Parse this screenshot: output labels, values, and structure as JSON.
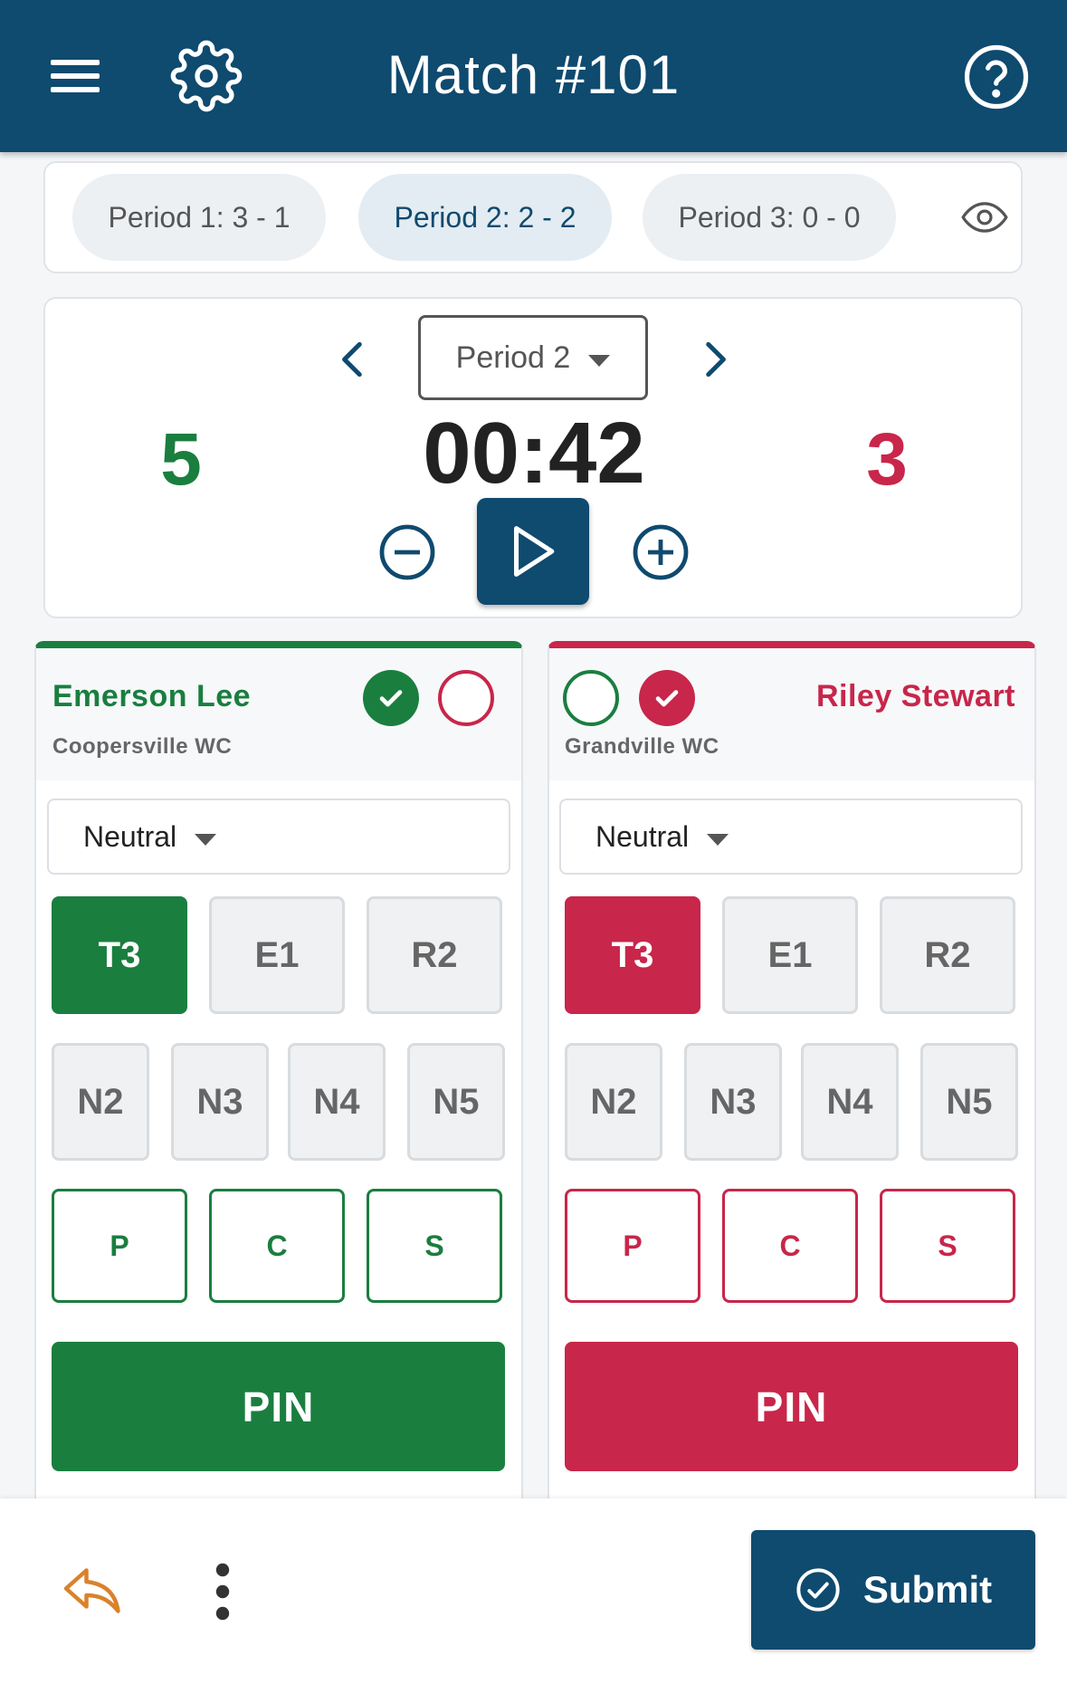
{
  "header": {
    "title": "Match #101"
  },
  "periods": [
    {
      "label": "Period 1: 3 - 1"
    },
    {
      "label": "Period 2: 2 - 2"
    },
    {
      "label": "Period 3: 0 - 0"
    }
  ],
  "timer": {
    "period_select": "Period 2",
    "clock": "00:42",
    "score_left": "5",
    "score_right": "3"
  },
  "wrestlers": {
    "left": {
      "name": "Emerson Lee",
      "team": "Coopersville WC",
      "position": "Neutral",
      "row1": [
        "T3",
        "E1",
        "R2"
      ],
      "row2": [
        "N2",
        "N3",
        "N4",
        "N5"
      ],
      "row3": [
        "P",
        "C",
        "S"
      ],
      "pin": "PIN"
    },
    "right": {
      "name": "Riley Stewart",
      "team": "Grandville WC",
      "position": "Neutral",
      "row1": [
        "T3",
        "E1",
        "R2"
      ],
      "row2": [
        "N2",
        "N3",
        "N4",
        "N5"
      ],
      "row3": [
        "P",
        "C",
        "S"
      ],
      "pin": "PIN"
    }
  },
  "footer": {
    "submit_label": "Submit"
  },
  "colors": {
    "header": "#0f4a6f",
    "green": "#1a7e3f",
    "red": "#c8264a"
  },
  "icons": [
    "menu-icon",
    "gear-icon",
    "help-icon",
    "eye-icon",
    "chevron-left-icon",
    "chevron-right-icon",
    "minus-icon",
    "play-icon",
    "plus-icon",
    "check-icon",
    "undo-icon",
    "more-vertical-icon",
    "check-circle-icon"
  ]
}
